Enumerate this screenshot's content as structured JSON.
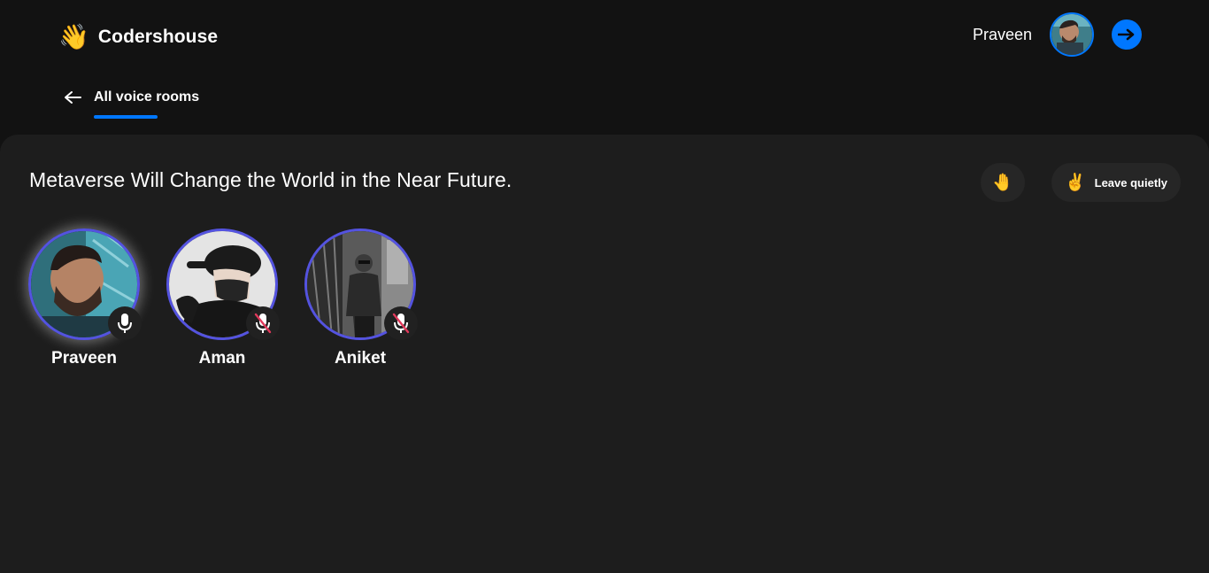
{
  "header": {
    "brand_emoji": "👋",
    "brand_name": "Codershouse",
    "user_name": "Praveen",
    "logout_icon": "arrow-right-icon",
    "accent_color": "#0077ff"
  },
  "subnav": {
    "back_icon": "arrow-left-icon",
    "label": "All voice rooms"
  },
  "room": {
    "topic": "Metaverse Will Change the World in the Near Future.",
    "hand_emoji": "🤚",
    "leave_emoji": "✌️",
    "leave_label": "Leave quietly"
  },
  "clients": [
    {
      "name": "Praveen",
      "mic": "on",
      "mic_icon": "mic-icon"
    },
    {
      "name": "Aman",
      "mic": "muted",
      "mic_icon": "mic-muted-icon"
    },
    {
      "name": "Aniket",
      "mic": "muted",
      "mic_icon": "mic-muted-icon"
    }
  ],
  "colors": {
    "background": "#121212",
    "panel": "#1d1d1d",
    "avatar_ring": "#5453e0",
    "muted_slash": "#e0395b"
  }
}
